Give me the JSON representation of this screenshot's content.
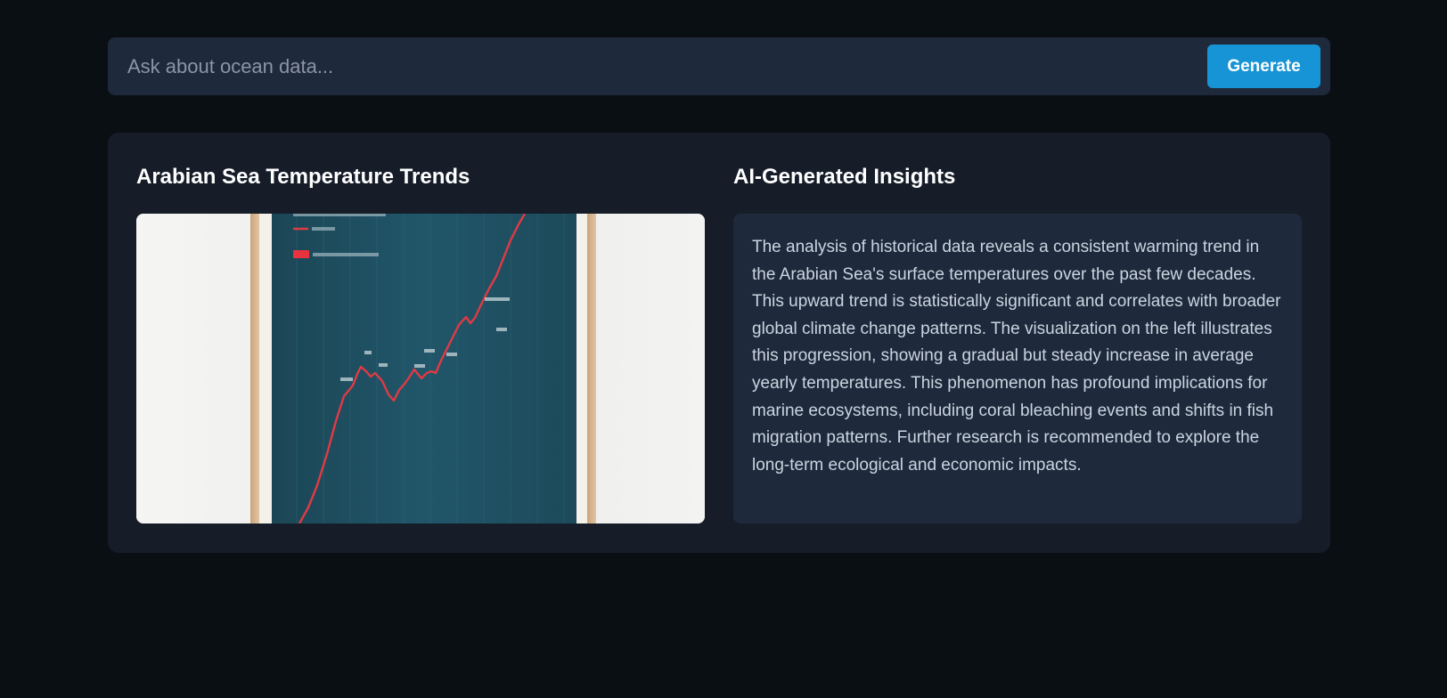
{
  "search": {
    "placeholder": "Ask about ocean data...",
    "value": ""
  },
  "generate_button": {
    "label": "Generate"
  },
  "chart_panel": {
    "title": "Arabian Sea Temperature Trends"
  },
  "insights_panel": {
    "title": "AI-Generated Insights",
    "text": "The analysis of historical data reveals a consistent warming trend in the Arabian Sea's surface temperatures over the past few decades. This upward trend is statistically significant and correlates with broader global climate change patterns. The visualization on the left illustrates this progression, showing a gradual but steady increase in average yearly temperatures. This phenomenon has profound implications for marine ecosystems, including coral bleaching events and shifts in fish migration patterns. Further research is recommended to explore the long-term ecological and economic impacts."
  },
  "colors": {
    "page_background": "#0a0f14",
    "panel_background": "#161d29",
    "input_background": "#1e293b",
    "accent": "#1794d6",
    "chart_line": "#e03a45",
    "chart_background": "#1f4d5e"
  }
}
